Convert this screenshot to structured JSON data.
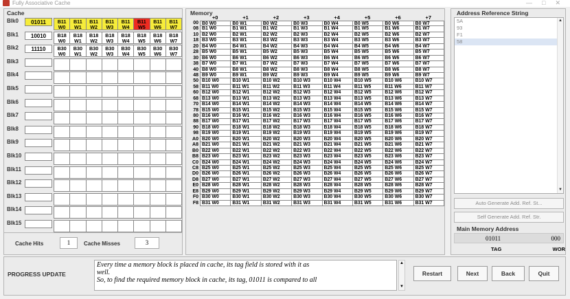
{
  "window": {
    "title": "Fully Associative Cache"
  },
  "cache": {
    "title": "Cache",
    "blocks": [
      {
        "label": "Blk0",
        "tag": "01011",
        "words": [
          "B11 W0",
          "B11 W1",
          "B11 W2",
          "B11 W3",
          "B11 W4",
          "B11 W5",
          "B11 W6",
          "B11 W7"
        ]
      },
      {
        "label": "Blk1",
        "tag": "10010",
        "words": [
          "B18 W0",
          "B18 W1",
          "B18 W2",
          "B18 W3",
          "B18 W4",
          "B18 W5",
          "B18 W6",
          "B18 W7"
        ]
      },
      {
        "label": "Blk2",
        "tag": "11110",
        "words": [
          "B30 W0",
          "B30 W1",
          "B30 W2",
          "B30 W3",
          "B30 W4",
          "B30 W5",
          "B30 W6",
          "B30 W7"
        ]
      },
      {
        "label": "Blk3",
        "tag": "",
        "words": [
          "",
          "",
          "",
          "",
          "",
          "",
          "",
          ""
        ]
      },
      {
        "label": "Blk4",
        "tag": "",
        "words": [
          "",
          "",
          "",
          "",
          "",
          "",
          "",
          ""
        ]
      },
      {
        "label": "Blk5",
        "tag": "",
        "words": [
          "",
          "",
          "",
          "",
          "",
          "",
          "",
          ""
        ]
      },
      {
        "label": "Blk6",
        "tag": "",
        "words": [
          "",
          "",
          "",
          "",
          "",
          "",
          "",
          ""
        ]
      },
      {
        "label": "Blk7",
        "tag": "",
        "words": [
          "",
          "",
          "",
          "",
          "",
          "",
          "",
          ""
        ]
      },
      {
        "label": "Blk8",
        "tag": "",
        "words": [
          "",
          "",
          "",
          "",
          "",
          "",
          "",
          ""
        ]
      },
      {
        "label": "Blk9",
        "tag": "",
        "words": [
          "",
          "",
          "",
          "",
          "",
          "",
          "",
          ""
        ]
      },
      {
        "label": "Blk10",
        "tag": "",
        "words": [
          "",
          "",
          "",
          "",
          "",
          "",
          "",
          ""
        ]
      },
      {
        "label": "Blk11",
        "tag": "",
        "words": [
          "",
          "",
          "",
          "",
          "",
          "",
          "",
          ""
        ]
      },
      {
        "label": "Blk12",
        "tag": "",
        "words": [
          "",
          "",
          "",
          "",
          "",
          "",
          "",
          ""
        ]
      },
      {
        "label": "Blk13",
        "tag": "",
        "words": [
          "",
          "",
          "",
          "",
          "",
          "",
          "",
          ""
        ]
      },
      {
        "label": "Blk14",
        "tag": "",
        "words": [
          "",
          "",
          "",
          "",
          "",
          "",
          "",
          ""
        ]
      },
      {
        "label": "Blk15",
        "tag": "",
        "words": [
          "",
          "",
          "",
          "",
          "",
          "",
          "",
          ""
        ]
      }
    ],
    "highlight": {
      "block": 0,
      "word": 5
    },
    "hits_label": "Cache Hits",
    "hits": "1",
    "misses_label": "Cache Misses",
    "misses": "3",
    "colors": {
      "hit_row": "#f6ec3a",
      "hit_word": "#ee2b20"
    }
  },
  "memory": {
    "title": "Memory",
    "offsets": [
      "+0",
      "+1",
      "+2",
      "+3",
      "+4",
      "+5",
      "+6",
      "+7"
    ],
    "addresses": [
      "00",
      "08",
      "10",
      "18",
      "20",
      "28",
      "30",
      "38",
      "40",
      "48",
      "50",
      "58",
      "60",
      "68",
      "70",
      "78",
      "80",
      "88",
      "90",
      "98",
      "A0",
      "A8",
      "B0",
      "B8",
      "C0",
      "C8",
      "D0",
      "D8",
      "E0",
      "E8",
      "F0",
      "F8"
    ]
  },
  "address_ref": {
    "title": "Address Reference String",
    "items": [
      "5A",
      "93",
      "F1",
      "58"
    ],
    "selected": 3,
    "auto_btn": "Auto Generate Add. Ref. St...",
    "self_btn": "Self Generate Add. Ref. Str.",
    "mma_title": "Main Memory Address",
    "mma_tag": "01011",
    "mma_word": "000",
    "tag_label": "TAG",
    "word_label": "WOR"
  },
  "progress": {
    "label": "PROGRESS UPDATE",
    "line1": "Every time a memory block is placed in cache, its tag field is stored with it as",
    "line2": "well.",
    "line3": "So, to find the required memory block in cache, its tag, 01011 is compared to all"
  },
  "buttons": {
    "restart": "Restart",
    "next": "Next",
    "back": "Back",
    "quit": "Quit"
  }
}
